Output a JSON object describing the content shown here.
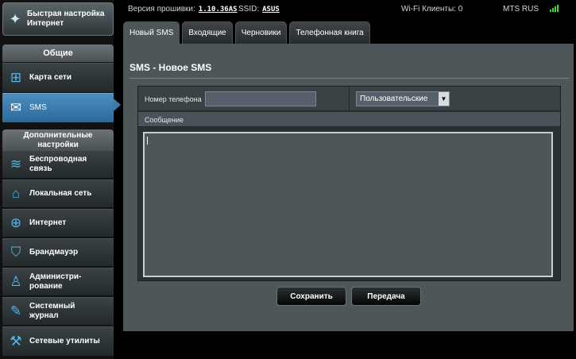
{
  "sidebar": {
    "quick_setup": "Быстрая настройка Интернет",
    "general_header": "Общие",
    "general_items": [
      {
        "label": "Карта сети",
        "icon": "network-map-icon"
      },
      {
        "label": "SMS",
        "icon": "envelope-icon"
      }
    ],
    "advanced_header": "Дополнительные настройки",
    "advanced_items": [
      {
        "label": "Беспроводная связь",
        "icon": "wifi-icon"
      },
      {
        "label": "Локальная сеть",
        "icon": "home-icon"
      },
      {
        "label": "Интернет",
        "icon": "globe-icon"
      },
      {
        "label": "Брандмауэр",
        "icon": "shield-icon"
      },
      {
        "label": "Администри-рование",
        "icon": "admin-user-icon"
      },
      {
        "label": "Системный журнал",
        "icon": "log-edit-icon"
      },
      {
        "label": "Сетевые утилиты",
        "icon": "tools-icon"
      }
    ]
  },
  "topbar": {
    "firmware_label": "Версия прошивки:",
    "firmware_value": "1.10.36AS",
    "ssid_label": "SSID:",
    "ssid_value": "ASUS",
    "wifi_clients": "Wi-Fi Клиенты: 0",
    "operator": "MTS RUS"
  },
  "tabs": [
    "Новый SMS",
    "Входящие",
    "Черновики",
    "Телефонная книга"
  ],
  "panel": {
    "title": "SMS - Новое SMS",
    "phone_label": "Номер телефона",
    "phone_value": "",
    "encoding_selected": "Пользовательские",
    "message_label": "Сообщение",
    "message_value": ""
  },
  "buttons": {
    "save": "Сохранить",
    "send": "Передача"
  },
  "colors": {
    "accent": "#3a7aad",
    "signal": "#3fd43f",
    "panel": "#4d5659"
  }
}
